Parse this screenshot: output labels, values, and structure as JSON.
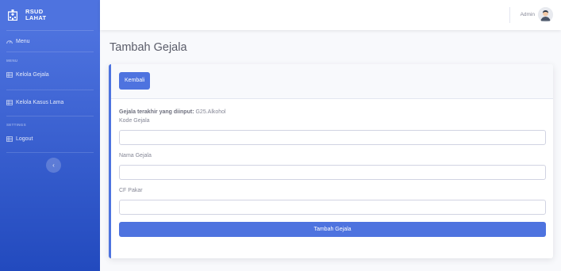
{
  "sidebar": {
    "brand_line1": "RSUD",
    "brand_line2": "LAHAT",
    "menu_label": "Menu",
    "heading_menu": "MENU",
    "items": [
      {
        "label": "Kelola Gejala"
      },
      {
        "label": "Kelola Kasus Lama"
      }
    ],
    "heading_settings": "SETTINGS",
    "logout_label": "Logout",
    "toggle_glyph": "‹"
  },
  "topbar": {
    "user_name": "Admin"
  },
  "page": {
    "title": "Tambah Gejala"
  },
  "card": {
    "back_label": "Kembali",
    "last_input_label": "Gejala terakhir yang diinput:",
    "last_input_value": " G25.Alkohol",
    "fields": [
      {
        "label": "Kode Gejala",
        "value": "",
        "placeholder": ""
      },
      {
        "label": "Nama Gejala",
        "value": "",
        "placeholder": ""
      },
      {
        "label": "CF Pakar",
        "value": "",
        "placeholder": ""
      }
    ],
    "submit_label": "Tambah Gejala"
  },
  "colors": {
    "primary": "#4e73df",
    "primary_dark": "#224abe",
    "text_muted": "#858796",
    "background": "#f8f9fc"
  },
  "icons": [
    "hospital-icon",
    "tachometer-icon",
    "table-icon",
    "user-avatar-icon",
    "chevron-left-icon"
  ]
}
